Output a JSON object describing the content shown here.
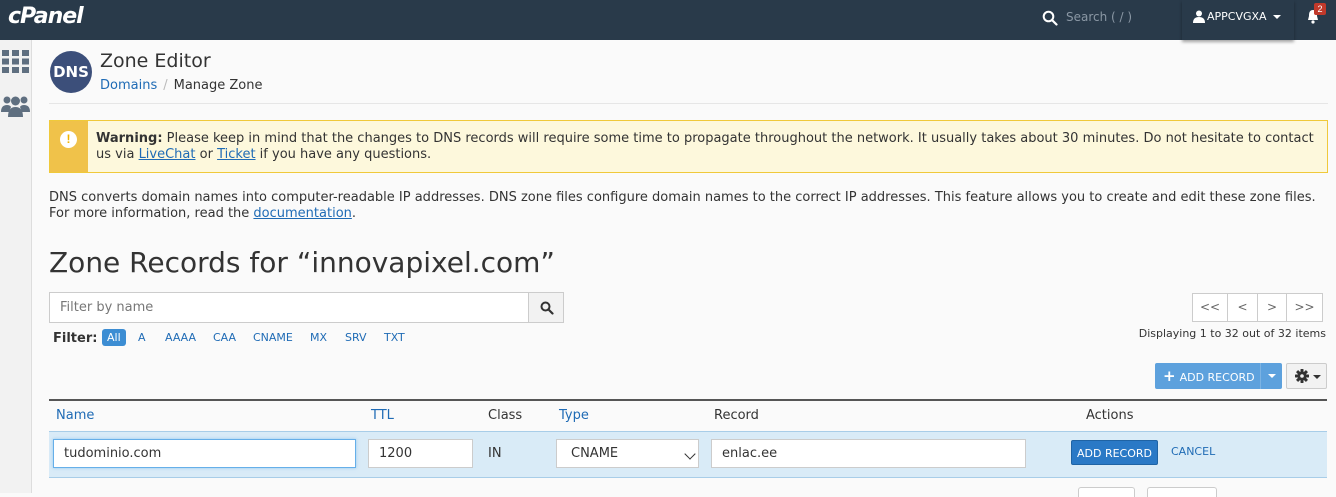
{
  "topbar": {
    "logo": "cPanel",
    "search_placeholder": "Search ( / )",
    "username": "APPCVGXA",
    "notification_count": "2"
  },
  "header": {
    "dns_logo": "DNS",
    "title": "Zone Editor",
    "breadcrumb": {
      "home": "Domains",
      "current": "Manage Zone"
    }
  },
  "warning": {
    "label": "Warning:",
    "text_1": " Please keep in mind that the changes to DNS records will require some time to propagate throughout the network. It usually takes about 30 minutes. Do not hesitate to contact us via ",
    "link_livechat": "LiveChat",
    "text_2": " or ",
    "link_ticket": "Ticket",
    "text_3": " if you have any questions."
  },
  "description": {
    "text": "DNS converts domain names into computer-readable IP addresses. DNS zone files configure domain names to the correct IP addresses. This feature allows you to create and edit these zone files. For more information, read the ",
    "link": "documentation",
    "end": "."
  },
  "zone_title": "Zone Records for “innovapixel.com”",
  "filter": {
    "placeholder": "Filter by name",
    "label": "Filter:",
    "types": [
      "All",
      "A",
      "AAAA",
      "CAA",
      "CNAME",
      "MX",
      "SRV",
      "TXT"
    ],
    "active": "All"
  },
  "pager": {
    "first": "<<",
    "prev": "<",
    "next": ">",
    "last": ">>",
    "displaying": "Displaying 1 to 32 out of 32 items"
  },
  "toolbar": {
    "add_record": "ADD RECORD"
  },
  "table": {
    "headers": {
      "name": "Name",
      "ttl": "TTL",
      "class": "Class",
      "type": "Type",
      "record": "Record",
      "actions": "Actions"
    },
    "edit_row": {
      "name": "tudominio.com",
      "ttl": "1200",
      "class": "IN",
      "type": "CNAME",
      "record": "enlac.ee",
      "save_label": "ADD RECORD",
      "cancel_label": "CANCEL"
    }
  },
  "colors": {
    "topbar": "#293a4a",
    "link": "#1f6bb5",
    "primary_button": "#2a79c6",
    "warning_bg": "#fdf8dc",
    "warning_accent": "#f0c24a",
    "row_highlight": "#d9ebf7"
  }
}
